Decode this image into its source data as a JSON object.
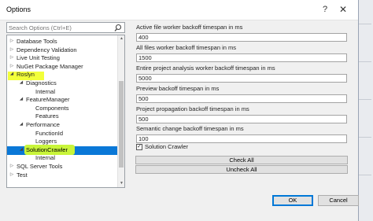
{
  "window": {
    "title": "Options",
    "help_glyph": "?",
    "close_glyph": "✕"
  },
  "search": {
    "placeholder": "Search Options (Ctrl+E)"
  },
  "tree": [
    {
      "label": "Database Tools",
      "level": 0,
      "arrow": "▷"
    },
    {
      "label": "Dependency Validation",
      "level": 0,
      "arrow": "▷"
    },
    {
      "label": "Live Unit Testing",
      "level": 0,
      "arrow": "▷"
    },
    {
      "label": "NuGet Package Manager",
      "level": 0,
      "arrow": "▷"
    },
    {
      "label": "Roslyn",
      "level": 0,
      "arrow": "◢",
      "highlight": true
    },
    {
      "label": "Diagnostics",
      "level": 1,
      "arrow": "◢"
    },
    {
      "label": "Internal",
      "level": 2,
      "arrow": ""
    },
    {
      "label": "FeatureManager",
      "level": 1,
      "arrow": "◢"
    },
    {
      "label": "Components",
      "level": 2,
      "arrow": ""
    },
    {
      "label": "Features",
      "level": 2,
      "arrow": ""
    },
    {
      "label": "Performance",
      "level": 1,
      "arrow": "◢"
    },
    {
      "label": "FunctionId",
      "level": 2,
      "arrow": ""
    },
    {
      "label": "Loggers",
      "level": 2,
      "arrow": ""
    },
    {
      "label": "SolutionCrawler",
      "level": 1,
      "arrow": "◢",
      "selected": true
    },
    {
      "label": "Internal",
      "level": 2,
      "arrow": ""
    },
    {
      "label": "SQL Server Tools",
      "level": 0,
      "arrow": "▷"
    },
    {
      "label": "Test",
      "level": 0,
      "arrow": "▷"
    }
  ],
  "settings": {
    "fields": [
      {
        "label": "Active file worker backoff timespan in ms",
        "value": "400"
      },
      {
        "label": "All files worker backoff timespan in ms",
        "value": "1500"
      },
      {
        "label": "Entire project analysis worker backoff timespan in ms",
        "value": "5000"
      },
      {
        "label": "Preview backoff timespan in ms",
        "value": "500"
      },
      {
        "label": "Project propagation backoff timespan in ms",
        "value": "500"
      },
      {
        "label": "Semantic change backoff timespan in ms",
        "value": "100"
      }
    ],
    "checkbox": {
      "label": "Solution Crawler",
      "checked": true,
      "mark": "✓"
    },
    "check_all": "Check All",
    "uncheck_all": "Uncheck All"
  },
  "buttons": {
    "ok": "OK",
    "cancel": "Cancel"
  },
  "colors": {
    "accent": "#0078d7",
    "selection": "#3399ff",
    "highlight_yellow": "#f2ff3a",
    "highlight_green": "#c6f233"
  }
}
